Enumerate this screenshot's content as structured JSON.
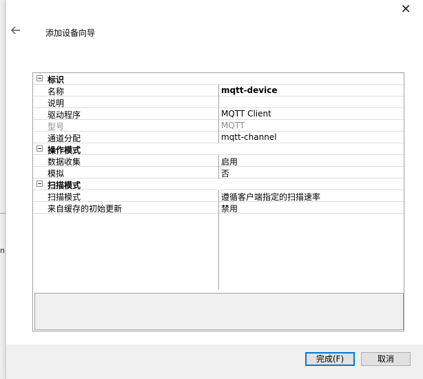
{
  "dialog": {
    "title": "添加设备向导",
    "close_glyph": "✕"
  },
  "background": {
    "partial_text": "n"
  },
  "grid": {
    "categories": [
      {
        "label": "标识",
        "properties": [
          {
            "name": "名称",
            "value": "mqtt-device",
            "bold": true,
            "disabled": false
          },
          {
            "name": "说明",
            "value": "",
            "bold": false,
            "disabled": false
          },
          {
            "name": "驱动程序",
            "value": "MQTT Client",
            "bold": false,
            "disabled": false
          },
          {
            "name": "型号",
            "value": "MQTT",
            "bold": false,
            "disabled": true
          },
          {
            "name": "通道分配",
            "value": "mqtt-channel",
            "bold": false,
            "disabled": false
          }
        ]
      },
      {
        "label": "操作模式",
        "properties": [
          {
            "name": "数据收集",
            "value": "启用",
            "bold": false,
            "disabled": false
          },
          {
            "name": "模拟",
            "value": "否",
            "bold": false,
            "disabled": false
          }
        ]
      },
      {
        "label": "扫描模式",
        "properties": [
          {
            "name": "扫描模式",
            "value": "遵循客户端指定的扫描速率",
            "bold": false,
            "disabled": false
          },
          {
            "name": "来自缓存的初始更新",
            "value": "禁用",
            "bold": false,
            "disabled": false
          }
        ]
      }
    ],
    "description": ""
  },
  "buttons": {
    "finish_label": "完成(F)",
    "cancel_label": "取消"
  },
  "colors": {
    "accent": "#0078d7",
    "disabled_text": "#8c8c8c"
  }
}
